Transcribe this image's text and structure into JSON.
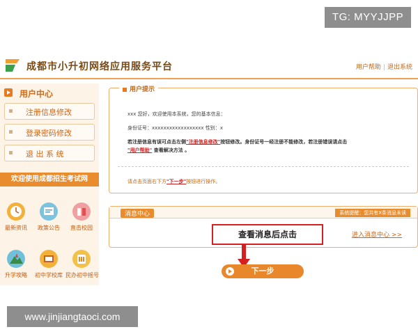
{
  "watermarks": {
    "tg": "TG: MYYJJPP",
    "url": "www.jinjiangtaoci.com"
  },
  "header": {
    "title": "成都市小升初网络应用服务平台",
    "help": "用户帮助",
    "separator": "|",
    "logout": "退出系统"
  },
  "sidebar": {
    "heading": "用户中心",
    "menu": [
      {
        "label": "注册信息修改"
      },
      {
        "label": "登录密码修改"
      },
      {
        "label": "退 出 系 统"
      }
    ],
    "welcome": "欢迎使用成都招生考试网",
    "icons": [
      {
        "label": "最新资讯",
        "icon": "clock-icon"
      },
      {
        "label": "政策公告",
        "icon": "notice-board-icon"
      },
      {
        "label": "直击校园",
        "icon": "campus-books-icon"
      },
      {
        "label": "升学攻略",
        "icon": "mountain-icon"
      },
      {
        "label": "初中学校库",
        "icon": "school-board-icon"
      },
      {
        "label": "民办初中摇号",
        "icon": "lottery-icon"
      }
    ]
  },
  "prompt_panel": {
    "title": "用户提示",
    "greeting": "xxx 您好，欢迎使用本系统，您的基本信息：",
    "id_prefix": "身份证号：",
    "id_value": "xxxxxxxxxxxxxxxxxx",
    "gender_label": " 性别：",
    "gender_value": "x",
    "l3a": "若注册信息有误可点击左侧",
    "l3_link": "\"注册信息修改\"",
    "l3b": "按钮修改。身份证号一经注册不能修改，若注册错误请点击",
    "l4_link": "\"用户帮助\"",
    "l4b": " 查看解决方法 。",
    "tip_a": "请点击页面右下方",
    "tip_link": "\"下一步\"",
    "tip_b": "按钮进行操作。"
  },
  "message_center": {
    "title": "消息中心",
    "notice": "系统提醒：您共有X条消息未读",
    "link": "进入消息中心 >>"
  },
  "annotation": "查看消息后点击",
  "next_button": "下一步",
  "colors": {
    "accent": "#e8872c",
    "link_red": "#d02020",
    "annotation_red": "#d42020"
  }
}
